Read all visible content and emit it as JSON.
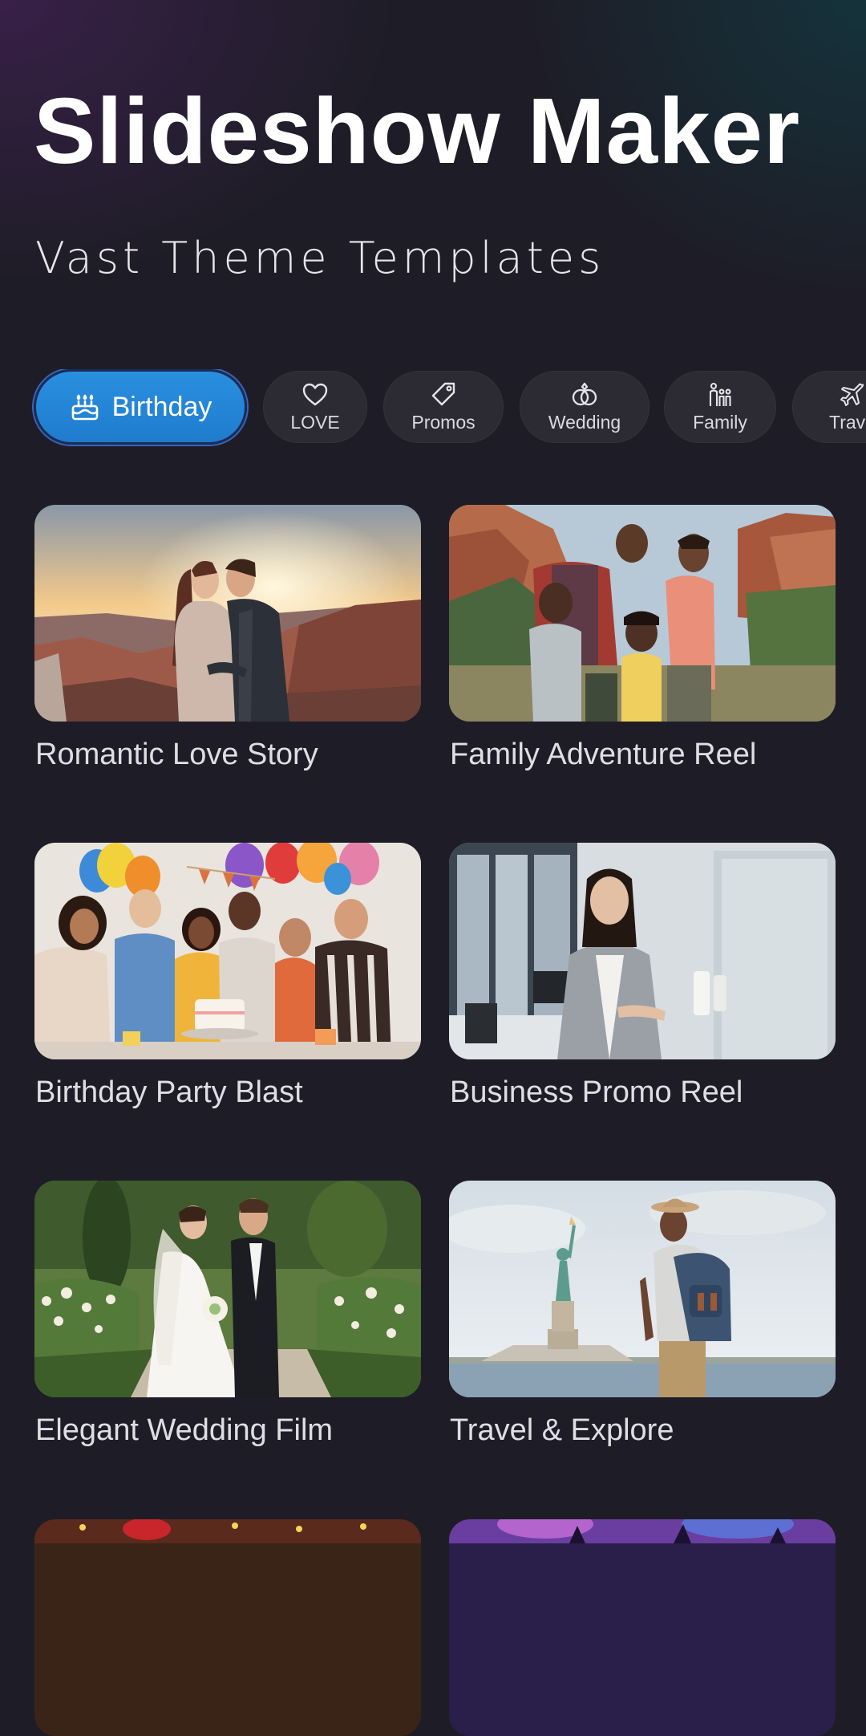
{
  "header": {
    "title": "Slideshow Maker",
    "subtitle": "Vast Theme Templates"
  },
  "categories": [
    {
      "label": "Birthday",
      "icon": "birthday-cake-icon",
      "active": true
    },
    {
      "label": "LOVE",
      "icon": "heart-icon",
      "active": false
    },
    {
      "label": "Promos",
      "icon": "tag-icon",
      "active": false
    },
    {
      "label": "Wedding",
      "icon": "rings-icon",
      "active": false
    },
    {
      "label": "Family",
      "icon": "family-icon",
      "active": false
    },
    {
      "label": "Trave",
      "icon": "airplane-icon",
      "active": false
    }
  ],
  "templates": [
    {
      "title": "Romantic Love Story"
    },
    {
      "title": "Family Adventure Reel"
    },
    {
      "title": "Birthday Party Blast"
    },
    {
      "title": "Business Promo Reel"
    },
    {
      "title": "Elegant Wedding Film"
    },
    {
      "title": "Travel & Explore"
    },
    {
      "title": ""
    },
    {
      "title": ""
    }
  ],
  "colors": {
    "background": "#1e1d27",
    "accent": "#2a8fe0",
    "chip": "#2c2b33",
    "text": "#dedee3"
  }
}
